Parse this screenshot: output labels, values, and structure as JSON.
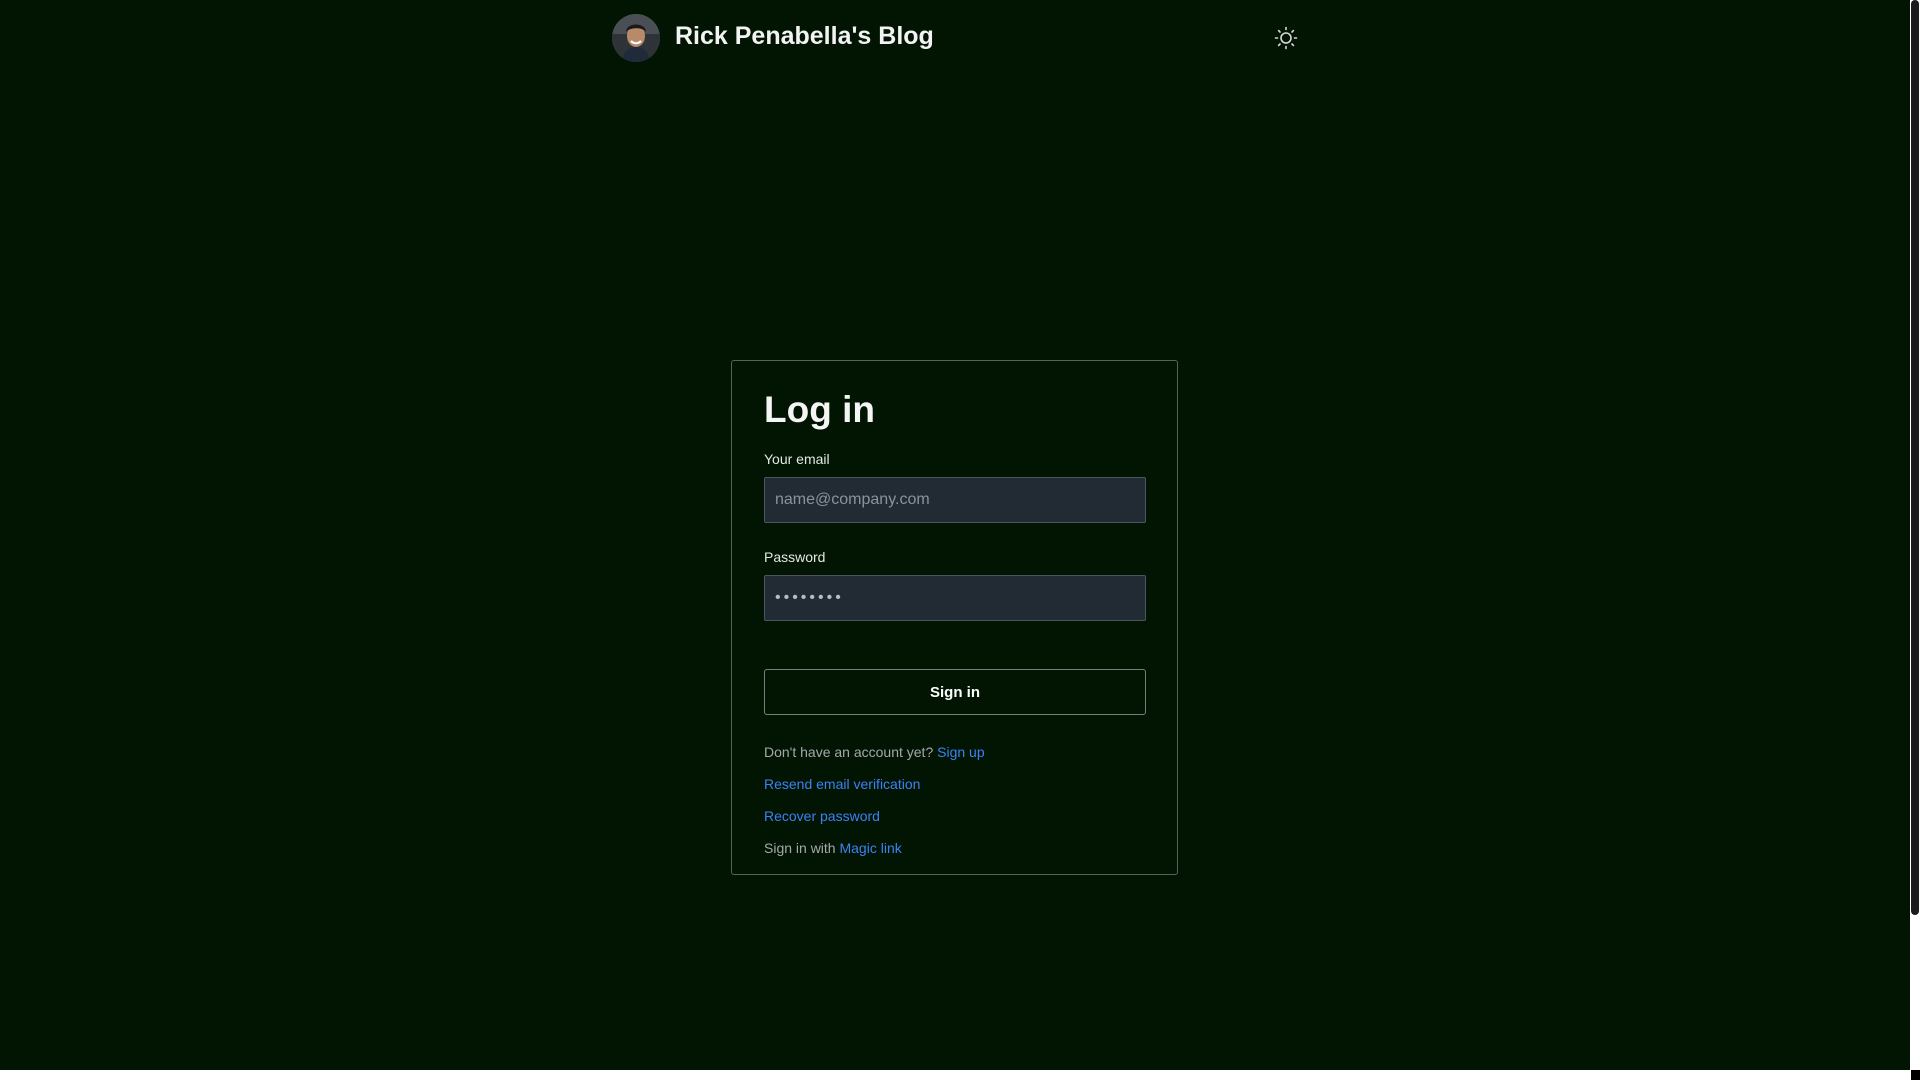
{
  "header": {
    "site_title": "Rick Penabella's Blog",
    "avatar_icon": "profile-photo",
    "theme_toggle_icon": "sun-icon"
  },
  "login": {
    "title": "Log in",
    "email_label": "Your email",
    "email_placeholder": "name@company.com",
    "email_value": "",
    "password_label": "Password",
    "password_value": "••••••••",
    "signin_label": "Sign in",
    "signup_prompt": "Don't have an account yet?",
    "signup_link": "Sign up",
    "resend_link": "Resend email verification",
    "recover_link": "Recover password",
    "magic_prompt": "Sign in with",
    "magic_link": "Magic link"
  },
  "colors": {
    "background": "#021503",
    "link": "#3b82f6",
    "input_bg": "#222a34"
  }
}
